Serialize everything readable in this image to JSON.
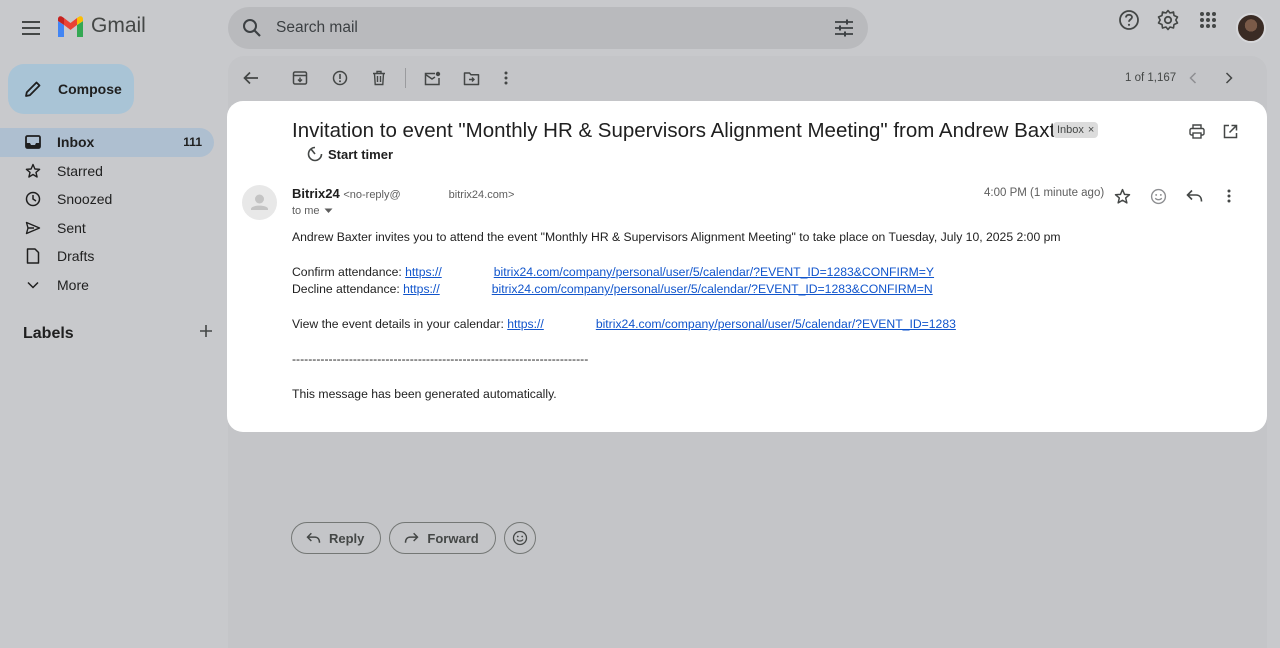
{
  "app": {
    "name": "Gmail"
  },
  "search": {
    "placeholder": "Search mail"
  },
  "compose": {
    "label": "Compose"
  },
  "nav": [
    {
      "label": "Inbox",
      "count": "111",
      "icon": "inbox-icon",
      "active": true
    },
    {
      "label": "Starred",
      "icon": "star-icon"
    },
    {
      "label": "Snoozed",
      "icon": "clock-icon"
    },
    {
      "label": "Sent",
      "icon": "send-icon"
    },
    {
      "label": "Drafts",
      "icon": "draft-icon"
    },
    {
      "label": "More",
      "icon": "chevron-down-icon"
    }
  ],
  "labels": {
    "heading": "Labels"
  },
  "toolbar": {
    "pager": "1 of 1,167"
  },
  "email": {
    "subject": "Invitation to event \"Monthly HR & Supervisors Alignment Meeting\" from Andrew Baxter",
    "tag": "Inbox",
    "timer_label": "Start timer",
    "sender_name": "Bitrix24",
    "sender_email_prefix": "<no-reply@",
    "sender_email_suffix": "bitrix24.com>",
    "recipient": "to me",
    "timestamp": "4:00 PM (1 minute ago)",
    "body": {
      "intro": "Andrew Baxter invites you to attend the event \"Monthly HR & Supervisors Alignment Meeting\" to take place on Tuesday, July 10, 2025 2:00 pm",
      "confirm_label": "Confirm attendance: ",
      "confirm_link_prefix": "https://",
      "confirm_link_suffix": "bitrix24.com/company/personal/user/5/calendar/?EVENT_ID=1283&CONFIRM=Y",
      "decline_label": "Decline attendance: ",
      "decline_link_prefix": "https://",
      "decline_link_suffix": "bitrix24.com/company/personal/user/5/calendar/?EVENT_ID=1283&CONFIRM=N",
      "view_label": "View the event details in your calendar: ",
      "view_link_prefix": "https://",
      "view_link_suffix": "bitrix24.com/company/personal/user/5/calendar/?EVENT_ID=1283",
      "separator": "-------------------------------------------------------------------------",
      "footer": "This message has been generated automatically."
    }
  },
  "actions": {
    "reply": "Reply",
    "forward": "Forward"
  },
  "colors": {
    "accent_link": "#1155cc",
    "gmail_red": "#ea4335",
    "gmail_blue": "#4285f4",
    "gmail_green": "#34a853",
    "gmail_yellow": "#fbbc04"
  }
}
